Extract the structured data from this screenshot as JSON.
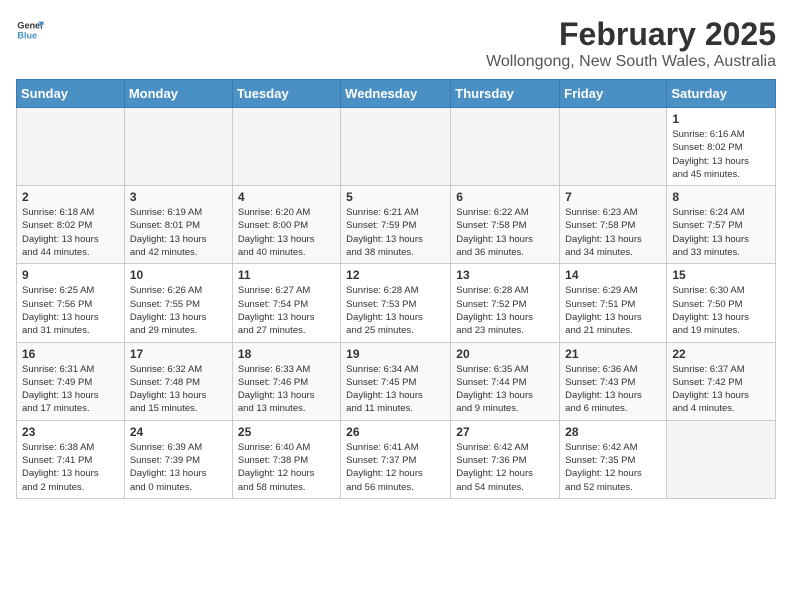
{
  "header": {
    "logo_general": "General",
    "logo_blue": "Blue",
    "title": "February 2025",
    "subtitle": "Wollongong, New South Wales, Australia"
  },
  "days_of_week": [
    "Sunday",
    "Monday",
    "Tuesday",
    "Wednesday",
    "Thursday",
    "Friday",
    "Saturday"
  ],
  "weeks": [
    [
      {
        "day": "",
        "info": ""
      },
      {
        "day": "",
        "info": ""
      },
      {
        "day": "",
        "info": ""
      },
      {
        "day": "",
        "info": ""
      },
      {
        "day": "",
        "info": ""
      },
      {
        "day": "",
        "info": ""
      },
      {
        "day": "1",
        "info": "Sunrise: 6:16 AM\nSunset: 8:02 PM\nDaylight: 13 hours\nand 45 minutes."
      }
    ],
    [
      {
        "day": "2",
        "info": "Sunrise: 6:18 AM\nSunset: 8:02 PM\nDaylight: 13 hours\nand 44 minutes."
      },
      {
        "day": "3",
        "info": "Sunrise: 6:19 AM\nSunset: 8:01 PM\nDaylight: 13 hours\nand 42 minutes."
      },
      {
        "day": "4",
        "info": "Sunrise: 6:20 AM\nSunset: 8:00 PM\nDaylight: 13 hours\nand 40 minutes."
      },
      {
        "day": "5",
        "info": "Sunrise: 6:21 AM\nSunset: 7:59 PM\nDaylight: 13 hours\nand 38 minutes."
      },
      {
        "day": "6",
        "info": "Sunrise: 6:22 AM\nSunset: 7:58 PM\nDaylight: 13 hours\nand 36 minutes."
      },
      {
        "day": "7",
        "info": "Sunrise: 6:23 AM\nSunset: 7:58 PM\nDaylight: 13 hours\nand 34 minutes."
      },
      {
        "day": "8",
        "info": "Sunrise: 6:24 AM\nSunset: 7:57 PM\nDaylight: 13 hours\nand 33 minutes."
      }
    ],
    [
      {
        "day": "9",
        "info": "Sunrise: 6:25 AM\nSunset: 7:56 PM\nDaylight: 13 hours\nand 31 minutes."
      },
      {
        "day": "10",
        "info": "Sunrise: 6:26 AM\nSunset: 7:55 PM\nDaylight: 13 hours\nand 29 minutes."
      },
      {
        "day": "11",
        "info": "Sunrise: 6:27 AM\nSunset: 7:54 PM\nDaylight: 13 hours\nand 27 minutes."
      },
      {
        "day": "12",
        "info": "Sunrise: 6:28 AM\nSunset: 7:53 PM\nDaylight: 13 hours\nand 25 minutes."
      },
      {
        "day": "13",
        "info": "Sunrise: 6:28 AM\nSunset: 7:52 PM\nDaylight: 13 hours\nand 23 minutes."
      },
      {
        "day": "14",
        "info": "Sunrise: 6:29 AM\nSunset: 7:51 PM\nDaylight: 13 hours\nand 21 minutes."
      },
      {
        "day": "15",
        "info": "Sunrise: 6:30 AM\nSunset: 7:50 PM\nDaylight: 13 hours\nand 19 minutes."
      }
    ],
    [
      {
        "day": "16",
        "info": "Sunrise: 6:31 AM\nSunset: 7:49 PM\nDaylight: 13 hours\nand 17 minutes."
      },
      {
        "day": "17",
        "info": "Sunrise: 6:32 AM\nSunset: 7:48 PM\nDaylight: 13 hours\nand 15 minutes."
      },
      {
        "day": "18",
        "info": "Sunrise: 6:33 AM\nSunset: 7:46 PM\nDaylight: 13 hours\nand 13 minutes."
      },
      {
        "day": "19",
        "info": "Sunrise: 6:34 AM\nSunset: 7:45 PM\nDaylight: 13 hours\nand 11 minutes."
      },
      {
        "day": "20",
        "info": "Sunrise: 6:35 AM\nSunset: 7:44 PM\nDaylight: 13 hours\nand 9 minutes."
      },
      {
        "day": "21",
        "info": "Sunrise: 6:36 AM\nSunset: 7:43 PM\nDaylight: 13 hours\nand 6 minutes."
      },
      {
        "day": "22",
        "info": "Sunrise: 6:37 AM\nSunset: 7:42 PM\nDaylight: 13 hours\nand 4 minutes."
      }
    ],
    [
      {
        "day": "23",
        "info": "Sunrise: 6:38 AM\nSunset: 7:41 PM\nDaylight: 13 hours\nand 2 minutes."
      },
      {
        "day": "24",
        "info": "Sunrise: 6:39 AM\nSunset: 7:39 PM\nDaylight: 13 hours\nand 0 minutes."
      },
      {
        "day": "25",
        "info": "Sunrise: 6:40 AM\nSunset: 7:38 PM\nDaylight: 12 hours\nand 58 minutes."
      },
      {
        "day": "26",
        "info": "Sunrise: 6:41 AM\nSunset: 7:37 PM\nDaylight: 12 hours\nand 56 minutes."
      },
      {
        "day": "27",
        "info": "Sunrise: 6:42 AM\nSunset: 7:36 PM\nDaylight: 12 hours\nand 54 minutes."
      },
      {
        "day": "28",
        "info": "Sunrise: 6:42 AM\nSunset: 7:35 PM\nDaylight: 12 hours\nand 52 minutes."
      },
      {
        "day": "",
        "info": ""
      }
    ]
  ]
}
